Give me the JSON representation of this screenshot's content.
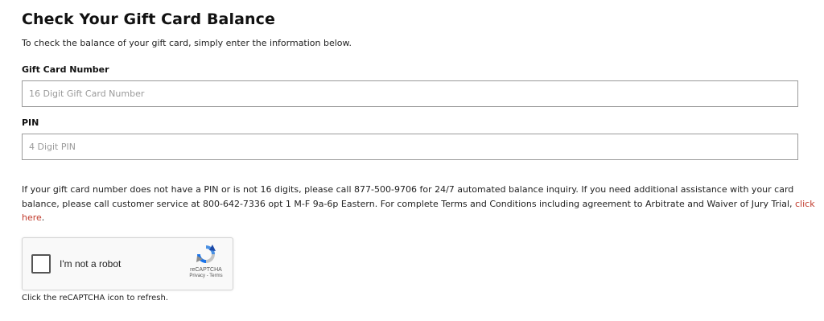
{
  "page": {
    "title": "Check Your Gift Card Balance",
    "intro": "To check the balance of your gift card, simply enter the information below."
  },
  "form": {
    "card_label": "Gift Card Number",
    "card_placeholder": "16 Digit Gift Card Number",
    "card_value": "",
    "pin_label": "PIN",
    "pin_placeholder": "4 Digit PIN",
    "pin_value": ""
  },
  "info": {
    "text": "If your gift card number does not have a PIN or is not 16 digits, please call 877-500-9706 for 24/7 automated balance inquiry. If you need additional assistance with your card balance, please call customer service at 800-642-7336 opt 1 M-F 9a-6p Eastern. For complete Terms and Conditions including agreement to Arbitrate and Waiver of Jury Trial, ",
    "link_text": "click here",
    "trailing": ".",
    "link_color": "#c0392b"
  },
  "recaptcha": {
    "label": "I'm not a robot",
    "brand": "reCAPTCHA",
    "links": "Privacy - Terms",
    "icon": "recaptcha-logo-icon",
    "checked": false
  },
  "refresh_note": "Click the reCAPTCHA icon to refresh."
}
